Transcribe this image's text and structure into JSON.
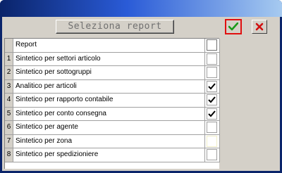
{
  "toolbar": {
    "title": "Seleziona report",
    "ok_icon": "green-checkmark-icon",
    "cancel_icon": "red-x-icon"
  },
  "grid": {
    "header": {
      "label": "Report",
      "checked": false
    },
    "rows": [
      {
        "num": "1",
        "label": "Sintetico per settori articolo",
        "checked": false
      },
      {
        "num": "2",
        "label": "Sintetico per sottogruppi",
        "checked": false
      },
      {
        "num": "3",
        "label": "Analitico per articoli",
        "checked": true
      },
      {
        "num": "4",
        "label": "Sintetico per rapporto contabile",
        "checked": true
      },
      {
        "num": "5",
        "label": "Sintetico per conto consegna",
        "checked": true
      },
      {
        "num": "6",
        "label": "Sintetico per agente",
        "checked": false
      },
      {
        "num": "7",
        "label": "Sintetico per zona",
        "checked": false
      },
      {
        "num": "8",
        "label": "Sintetico per spedizioniere",
        "checked": false
      }
    ]
  },
  "colors": {
    "titlebar": "#0a246a",
    "face": "#d4d0c8",
    "ok_green": "#1a9a1a",
    "cancel_red": "#d01010",
    "focus_border": "#e01010"
  }
}
